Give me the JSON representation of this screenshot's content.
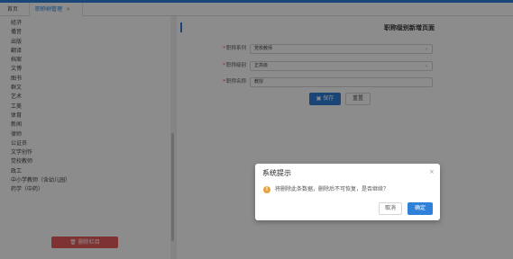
{
  "tabs": {
    "home": "首页",
    "active": "职称树管理",
    "close_glyph": "×"
  },
  "categories": [
    "经济",
    "播音",
    "出版",
    "翻译",
    "档案",
    "文博",
    "图书",
    "群文",
    "艺术",
    "工美",
    "体育",
    "新闻",
    "律师",
    "公证员",
    "文学创作",
    "党校教师",
    "政工",
    "中小学教师（含幼儿园）",
    "药学（中药）"
  ],
  "left_panel": {
    "delete_button": "删除栏目",
    "delete_icon": "trash-icon"
  },
  "form": {
    "title": "职称级别新增页面",
    "fields": [
      {
        "label": "职称系列",
        "value": "党校教师",
        "type": "select"
      },
      {
        "label": "职称级别",
        "value": "正高级",
        "type": "select"
      },
      {
        "label": "职称名称",
        "value": "教授",
        "type": "text"
      }
    ],
    "required_mark": "*",
    "chevron": "⌄",
    "save_button": "保存",
    "save_icon": "save-icon",
    "reset_button": "重置"
  },
  "dialog": {
    "title": "系统提示",
    "message": "将删除此条数据，删除后不可恢复，是否继续？",
    "warn_glyph": "!",
    "cancel_button": "取消",
    "ok_button": "确定",
    "close_glyph": "×"
  },
  "colors": {
    "accent": "#2f80d8",
    "danger": "#e85b5b",
    "warning": "#e6a23c"
  }
}
